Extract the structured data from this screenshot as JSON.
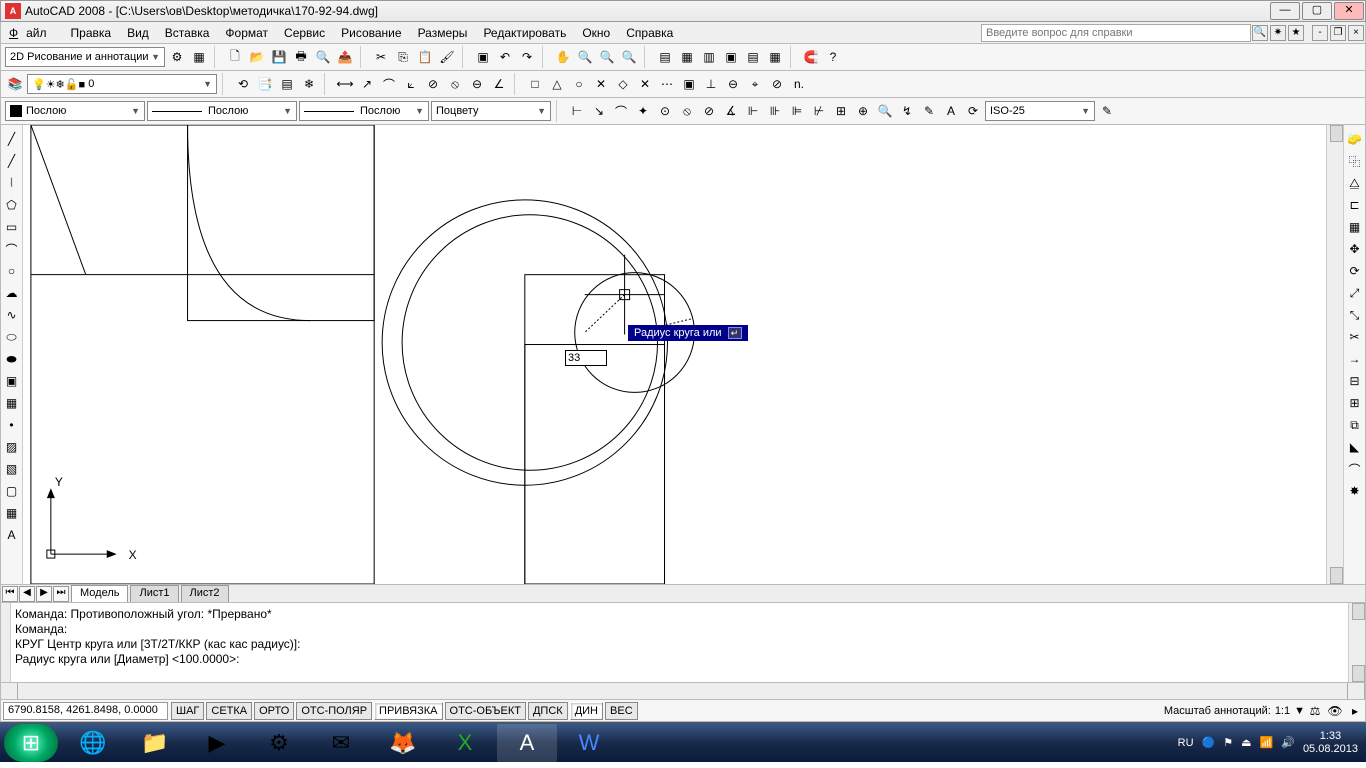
{
  "title": "AutoCAD 2008 - [C:\\Users\\ов\\Desktop\\методичка\\170-92-94.dwg]",
  "app_icon_text": "A",
  "menu": {
    "file": "Файл",
    "edit": "Правка",
    "view": "Вид",
    "insert": "Вставка",
    "format": "Формат",
    "service": "Сервис",
    "draw": "Рисование",
    "dimensions": "Размеры",
    "modify": "Редактировать",
    "window": "Окно",
    "help": "Справка",
    "help_placeholder": "Введите вопрос для справки"
  },
  "workspace_combo": "2D Рисование и аннотации",
  "layer_combo": "0",
  "color_combo": "Послою",
  "linetype_combo": "Послою",
  "lineweight_combo": "Послою",
  "plotstyle_combo": "Поцвету",
  "dimstyle_combo": "ISO-25",
  "tabs": {
    "model": "Модель",
    "sheet1": "Лист1",
    "sheet2": "Лист2"
  },
  "cmd_history": "Команда: Противоположный угол: *Прервано*\nКоманда:\nКРУГ Центр круга или [3Т/2Т/ККР (кас кас радиус)]:\n",
  "cmd_prompt": "Радиус круга или [Диаметр] <100.0000>:",
  "status": {
    "coords": "6790.8158, 4261.8498, 0.0000",
    "snap": "ШАГ",
    "grid": "СЕТКА",
    "ortho": "ОРТО",
    "polar": "ОТС-ПОЛЯР",
    "osnap": "ПРИВЯЗКА",
    "otrack": "ОТС-ОБЪЕКТ",
    "ducs": "ДПСК",
    "dyn": "ДИН",
    "lwt": "ВЕС",
    "annoscale_label": "Масштаб аннотаций:",
    "annoscale_value": "1:1"
  },
  "dynamic_input": {
    "value": "33",
    "tooltip": "Радиус круга или"
  },
  "ucs": {
    "x": "X",
    "y": "Y"
  },
  "tray": {
    "lang": "RU",
    "time": "1:33",
    "date": "05.08.2013"
  }
}
